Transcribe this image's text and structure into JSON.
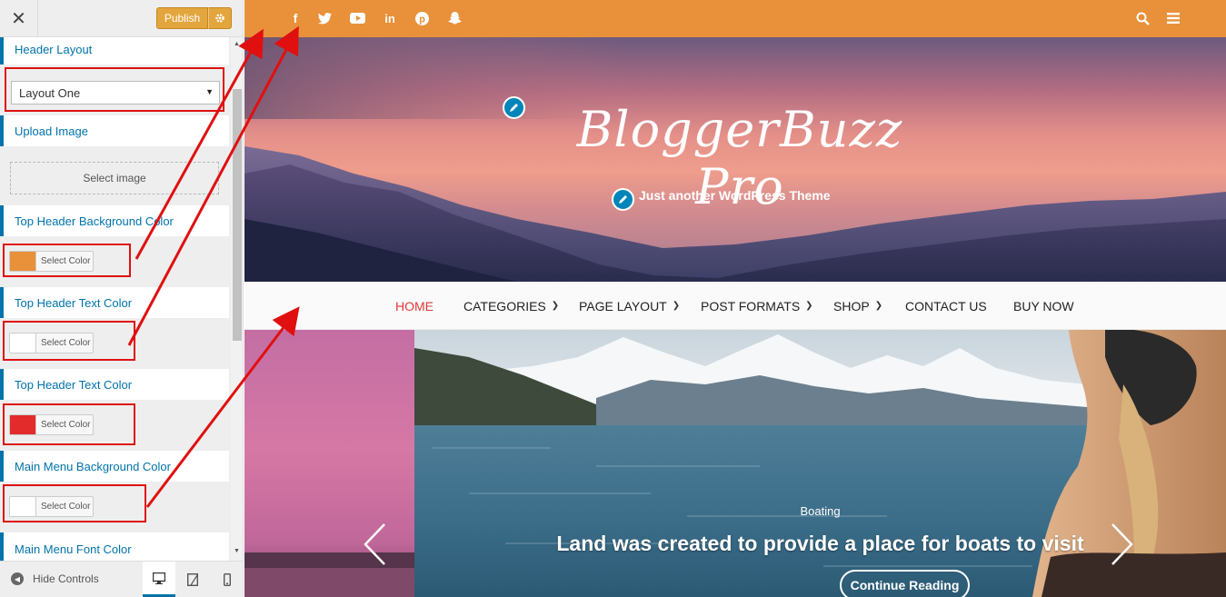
{
  "customizer": {
    "close_glyph": "✕",
    "publish_label": "Publish",
    "controls": [
      {
        "title": "Header Layout"
      },
      {
        "title": "Upload Image"
      },
      {
        "title": "Top Header Background Color"
      },
      {
        "title": "Top Header Text Color"
      },
      {
        "title": "Top Header Text Color"
      },
      {
        "title": "Main Menu Background Color"
      },
      {
        "title": "Main Menu Font Color"
      }
    ],
    "header_layout_value": "Layout One",
    "select_image_label": "Select image",
    "color_pickers": [
      {
        "label": "Select Color",
        "color": "#e8913a"
      },
      {
        "label": "Select Color",
        "color": "#ffffff"
      },
      {
        "label": "Select Color",
        "color": "#e32b2b"
      },
      {
        "label": "Select Color",
        "color": "#ffffff"
      }
    ],
    "hide_controls_label": "Hide Controls"
  },
  "site": {
    "title": "BloggerBuzz Pro",
    "tagline": "Just another WordPress Theme",
    "topbar_color": "#e8913a",
    "social_icons": [
      "facebook-icon",
      "twitter-icon",
      "youtube-icon",
      "linkedin-icon",
      "pinterest-icon",
      "snapchat-icon"
    ],
    "menu": [
      {
        "label": "HOME",
        "active": true
      },
      {
        "label": "CATEGORIES",
        "dropdown": true
      },
      {
        "label": "PAGE LAYOUT",
        "dropdown": true
      },
      {
        "label": "POST FORMATS",
        "dropdown": true
      },
      {
        "label": "SHOP",
        "dropdown": true
      },
      {
        "label": "CONTACT US"
      },
      {
        "label": "BUY NOW"
      }
    ],
    "active_menu_color": "#e03a3a",
    "slide": {
      "category": "Boating",
      "title": "Land was created to provide a place for boats to visit",
      "button": "Continue Reading"
    }
  },
  "annotation_color": "#e01010"
}
